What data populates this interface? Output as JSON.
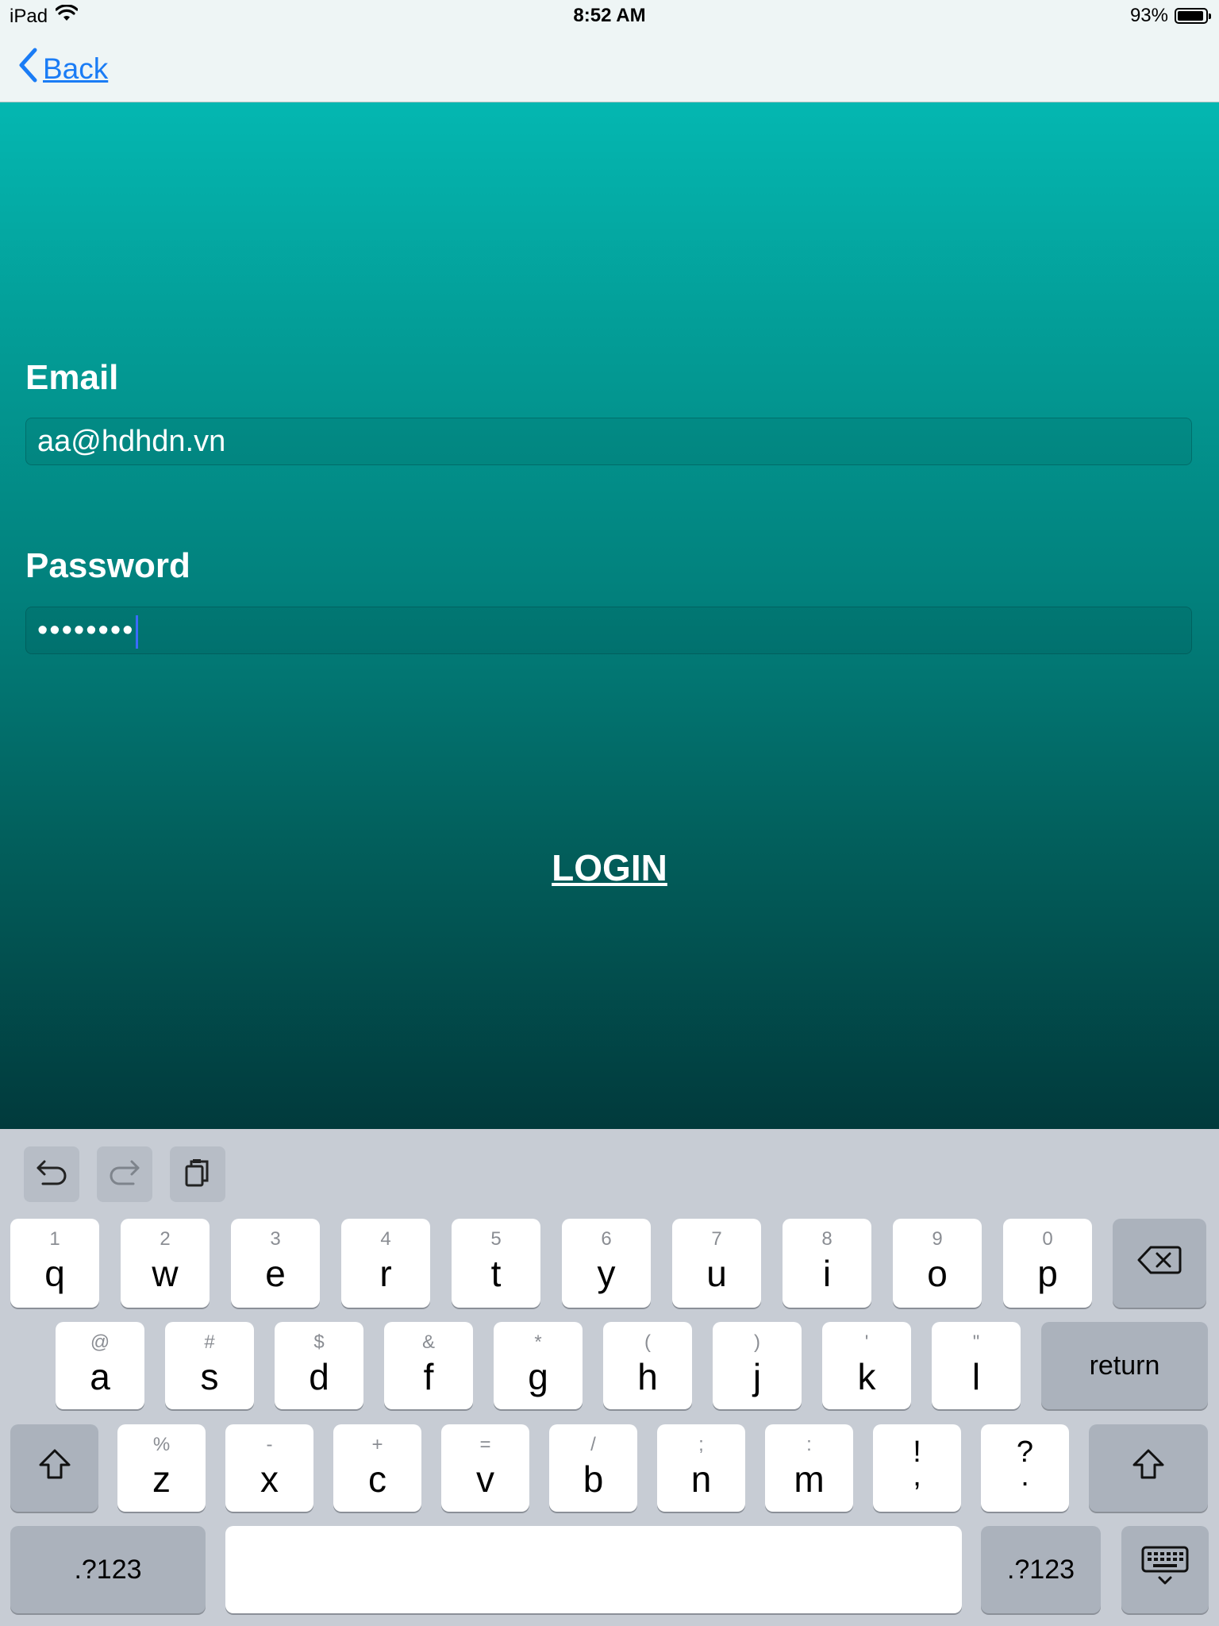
{
  "status_bar": {
    "device": "iPad",
    "time": "8:52 AM",
    "battery": "93%",
    "battery_level": 0.93
  },
  "nav": {
    "back_label": "Back"
  },
  "form": {
    "email_label": "Email",
    "email_value": "aa@hdhdn.vn",
    "password_label": "Password",
    "password_value": "••••••••",
    "login_label": "LOGIN"
  },
  "keyboard": {
    "row1": [
      {
        "sub": "1",
        "key": "q"
      },
      {
        "sub": "2",
        "key": "w"
      },
      {
        "sub": "3",
        "key": "e"
      },
      {
        "sub": "4",
        "key": "r"
      },
      {
        "sub": "5",
        "key": "t"
      },
      {
        "sub": "6",
        "key": "y"
      },
      {
        "sub": "7",
        "key": "u"
      },
      {
        "sub": "8",
        "key": "i"
      },
      {
        "sub": "9",
        "key": "o"
      },
      {
        "sub": "0",
        "key": "p"
      }
    ],
    "row2": [
      {
        "sub": "@",
        "key": "a"
      },
      {
        "sub": "#",
        "key": "s"
      },
      {
        "sub": "$",
        "key": "d"
      },
      {
        "sub": "&",
        "key": "f"
      },
      {
        "sub": "*",
        "key": "g"
      },
      {
        "sub": "(",
        "key": "h"
      },
      {
        "sub": ")",
        "key": "j"
      },
      {
        "sub": "'",
        "key": "k"
      },
      {
        "sub": "\"",
        "key": "l"
      }
    ],
    "row3": [
      {
        "sub": "%",
        "key": "z"
      },
      {
        "sub": "-",
        "key": "x"
      },
      {
        "sub": "+",
        "key": "c"
      },
      {
        "sub": "=",
        "key": "v"
      },
      {
        "sub": "/",
        "key": "b"
      },
      {
        "sub": ";",
        "key": "n"
      },
      {
        "sub": ":",
        "key": "m"
      }
    ],
    "row3_punct": [
      {
        "top": "!",
        "bottom": ","
      },
      {
        "top": "?",
        "bottom": "."
      }
    ],
    "return_label": "return",
    "numbers_label": ".?123",
    "numbers_label_right": ".?123"
  },
  "colors": {
    "accent": "#1a7cf5",
    "gradient_top": "#04b7b1",
    "gradient_bottom": "#013a3c"
  }
}
